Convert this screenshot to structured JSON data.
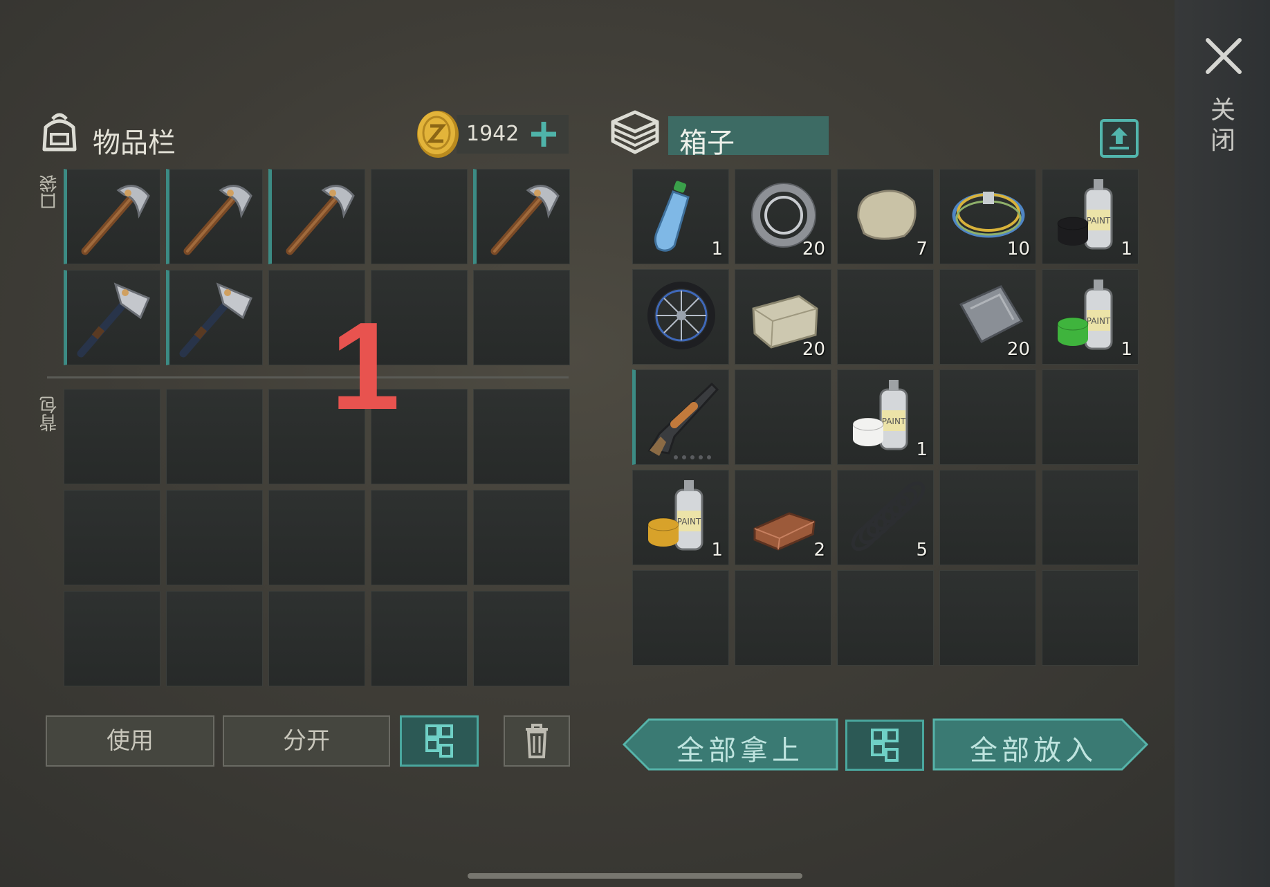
{
  "inventory": {
    "title": "物品栏",
    "pocket_label": "口袋",
    "backpack_label": "背包",
    "coins": "1942",
    "pocket_slots": [
      {
        "item": "pickaxe",
        "qty": ""
      },
      {
        "item": "pickaxe",
        "qty": ""
      },
      {
        "item": "pickaxe",
        "qty": ""
      },
      {
        "item": "",
        "qty": ""
      },
      {
        "item": "pickaxe",
        "qty": ""
      },
      {
        "item": "hatchet",
        "qty": ""
      },
      {
        "item": "hatchet",
        "qty": ""
      },
      {
        "item": "",
        "qty": ""
      },
      {
        "item": "",
        "qty": ""
      },
      {
        "item": "",
        "qty": ""
      }
    ],
    "backpack_slot_count": 15,
    "buttons": {
      "use": "使用",
      "split": "分开"
    }
  },
  "overlay_number": "1",
  "container": {
    "title": "箱子",
    "slots": [
      {
        "item": "water-bottle",
        "qty": "1"
      },
      {
        "item": "bearing",
        "qty": "20"
      },
      {
        "item": "stone",
        "qty": "7"
      },
      {
        "item": "wire-coil",
        "qty": "10"
      },
      {
        "item": "spray-paint-black",
        "qty": "1"
      },
      {
        "item": "wheel",
        "qty": ""
      },
      {
        "item": "limestone-block",
        "qty": "20"
      },
      {
        "item": "",
        "qty": ""
      },
      {
        "item": "metal-plate",
        "qty": "20"
      },
      {
        "item": "spray-paint-green",
        "qty": "1"
      },
      {
        "item": "shotgun",
        "qty": ""
      },
      {
        "item": "",
        "qty": ""
      },
      {
        "item": "spray-paint-white",
        "qty": "1"
      },
      {
        "item": "",
        "qty": ""
      },
      {
        "item": "",
        "qty": ""
      },
      {
        "item": "spray-paint-yellow",
        "qty": "1"
      },
      {
        "item": "copper-ingot",
        "qty": "2"
      },
      {
        "item": "spring",
        "qty": "5"
      },
      {
        "item": "",
        "qty": ""
      },
      {
        "item": "",
        "qty": ""
      },
      {
        "item": "",
        "qty": ""
      },
      {
        "item": "",
        "qty": ""
      },
      {
        "item": "",
        "qty": ""
      },
      {
        "item": "",
        "qty": ""
      },
      {
        "item": "",
        "qty": ""
      }
    ],
    "buttons": {
      "take_all": "全部拿上",
      "put_all": "全部放入"
    }
  },
  "close_label": "关闭",
  "colors": {
    "accent": "#4aa79e",
    "teal_field": "#3d6b64",
    "number_red": "#e8534f"
  }
}
